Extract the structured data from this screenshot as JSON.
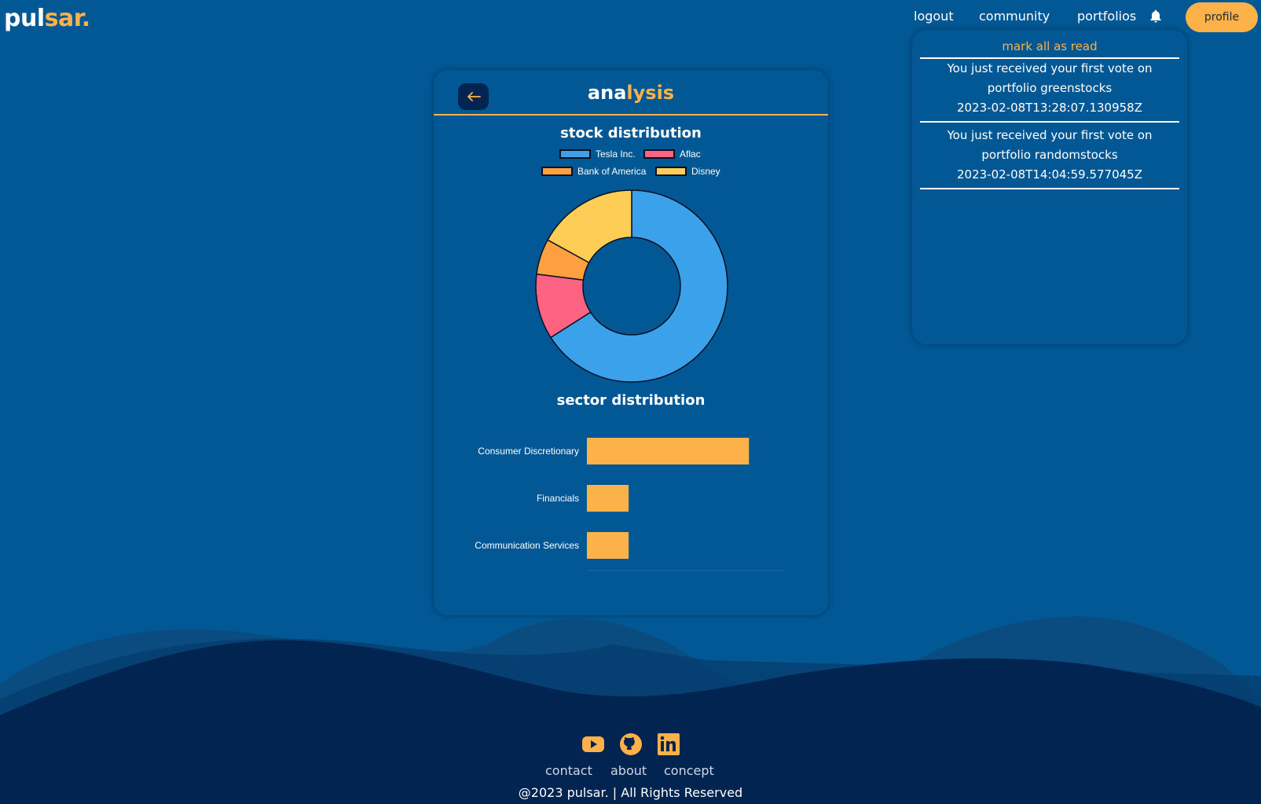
{
  "nav": {
    "logo_part1": "pul",
    "logo_part2": "sar.",
    "links": [
      "logout",
      "community",
      "portfolios"
    ],
    "profile": "profile"
  },
  "notifications": {
    "mark_all": "mark all as read",
    "items": [
      {
        "message": "You just received your first vote on portfolio greenstocks",
        "timestamp": "2023-02-08T13:28:07.130958Z"
      },
      {
        "message": "You just received your first vote on portfolio randomstocks",
        "timestamp": "2023-02-08T14:04:59.577045Z"
      }
    ]
  },
  "card": {
    "title_part1": "ana",
    "title_part2": "lysis",
    "stock_title": "stock distribution",
    "sector_title": "sector distribution"
  },
  "colors": {
    "background": "#025895",
    "accent": "#fcb249",
    "dark": "#012451"
  },
  "chart_data": [
    {
      "type": "pie",
      "title": "stock distribution",
      "categories": [
        "Tesla Inc.",
        "Aflac",
        "Bank of America",
        "Disney"
      ],
      "values": [
        66,
        11,
        6,
        17
      ],
      "colors": [
        "#3ba1eb",
        "#fe6384",
        "#fe9f40",
        "#fecd56"
      ],
      "legend": "top"
    },
    {
      "type": "bar",
      "title": "sector distribution",
      "orientation": "horizontal",
      "categories": [
        "Consumer Discretionary",
        "Financials",
        "Communication Services"
      ],
      "values": [
        66,
        17,
        17
      ],
      "color": "#fcb249",
      "xlim": [
        0,
        80
      ]
    }
  ],
  "footer": {
    "icons": [
      "youtube-icon",
      "github-icon",
      "linkedin-icon"
    ],
    "links": [
      "contact",
      "about",
      "concept"
    ],
    "copyright": "@2023 pulsar. | All Rights Reserved"
  }
}
